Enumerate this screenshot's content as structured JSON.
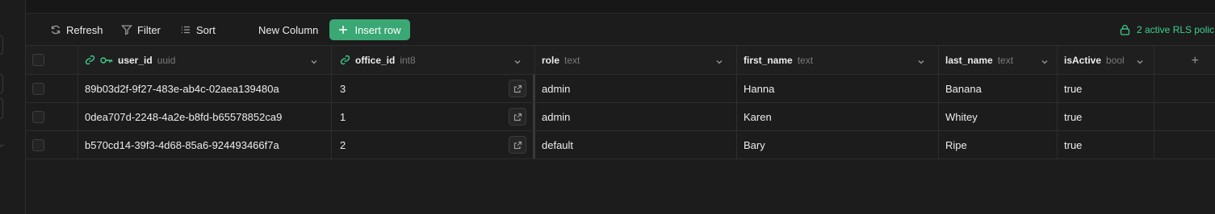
{
  "toolbar": {
    "refresh_label": "Refresh",
    "filter_label": "Filter",
    "sort_label": "Sort",
    "new_column_label": "New Column",
    "insert_row_label": "Insert row",
    "rls_label": "2 active RLS polic"
  },
  "colors": {
    "accent": "#3ecf8e",
    "button_bg": "#3aa874",
    "background": "#1c1c1c"
  },
  "columns": [
    {
      "name": "user_id",
      "type": "uuid",
      "icons": [
        "link-icon",
        "key-icon"
      ]
    },
    {
      "name": "office_id",
      "type": "int8",
      "icons": [
        "link-icon"
      ]
    },
    {
      "name": "role",
      "type": "text",
      "icons": []
    },
    {
      "name": "first_name",
      "type": "text",
      "icons": []
    },
    {
      "name": "last_name",
      "type": "text",
      "icons": []
    },
    {
      "name": "isActive",
      "type": "bool",
      "icons": []
    }
  ],
  "rows": [
    {
      "user_id": "89b03d2f-9f27-483e-ab4c-02aea139480a",
      "office_id": "3",
      "role": "admin",
      "first_name": "Hanna",
      "last_name": "Banana",
      "isActive": "true"
    },
    {
      "user_id": "0dea707d-2248-4a2e-b8fd-b65578852ca9",
      "office_id": "1",
      "role": "admin",
      "first_name": "Karen",
      "last_name": "Whitey",
      "isActive": "true"
    },
    {
      "user_id": "b570cd14-39f3-4d68-85a6-924493466f7a",
      "office_id": "2",
      "role": "default",
      "first_name": "Bary",
      "last_name": "Ripe",
      "isActive": "true"
    }
  ]
}
